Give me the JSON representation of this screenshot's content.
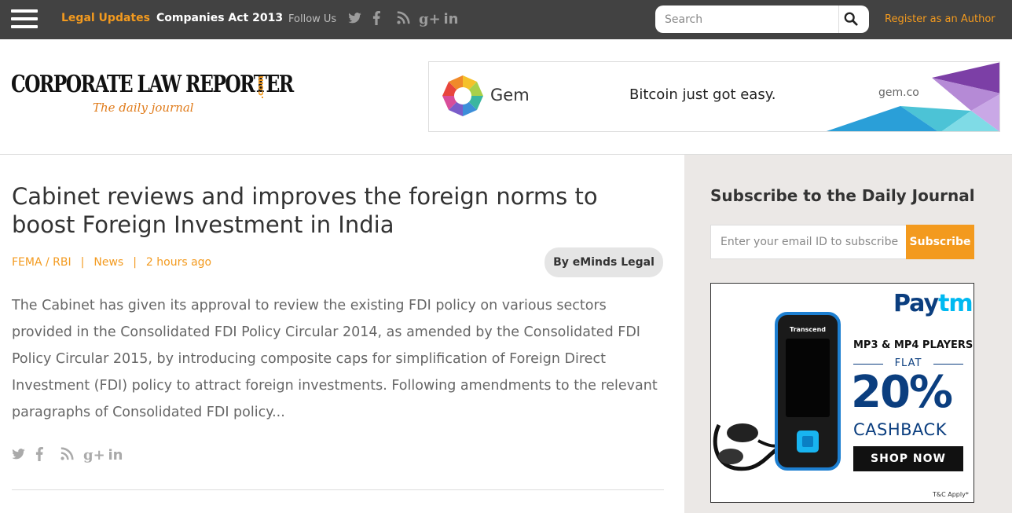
{
  "topbar": {
    "nav": [
      {
        "label": "Legal Updates"
      },
      {
        "label": "Companies Act 2013"
      }
    ],
    "follow_label": "Follow Us",
    "social_icons": [
      "twitter-icon",
      "facebook-icon",
      "rss-icon",
      "google-plus-icon",
      "linkedin-icon"
    ],
    "search_placeholder": "Search",
    "register_label": "Register as an Author"
  },
  "header": {
    "logo": {
      "main": "CORPORATE LAW REPORTER",
      "domain": ".com",
      "tagline": "The daily journal"
    },
    "ad": {
      "brand": "Gem",
      "tagline": "Bitcoin just got easy.",
      "url": "gem.co"
    }
  },
  "article": {
    "title": "Cabinet reviews and improves the foreign norms to boost Foreign Investment in India",
    "category": "FEMA / RBI",
    "section": "News",
    "time": "2 hours ago",
    "author": "By eMinds Legal",
    "excerpt": "The Cabinet has given its approval to review the existing FDI policy on various sectors provided in the Consolidated FDI Policy Circular 2014, as amended by the Consolidated FDI Policy Circular 2015, by introducing composite caps for simplification of Foreign Direct Investment (FDI) policy to attract foreign investments. Following amendments to the relevant paragraphs of Consolidated FDI policy...",
    "share_icons": [
      "twitter-icon",
      "facebook-icon",
      "rss-icon",
      "google-plus-icon",
      "linkedin-icon"
    ]
  },
  "sidebar": {
    "subscribe_title": "Subscribe to the Daily Journal",
    "email_placeholder": "Enter your email ID to subscribe",
    "subscribe_button": "Subscribe",
    "ad": {
      "brand_a": "Pay",
      "brand_b": "tm",
      "product": "MP3 & MP4 PLAYERS",
      "flat": "FLAT",
      "percent": "20%",
      "cashback": "CASHBACK",
      "cta": "SHOP NOW",
      "device_brand": "Transcend",
      "terms": "T&C Apply*"
    }
  },
  "colors": {
    "accent": "#f39a1e",
    "topbar": "#424242",
    "sidebar_bg": "#ebe8e6",
    "paytm_navy": "#0b3e7f"
  }
}
